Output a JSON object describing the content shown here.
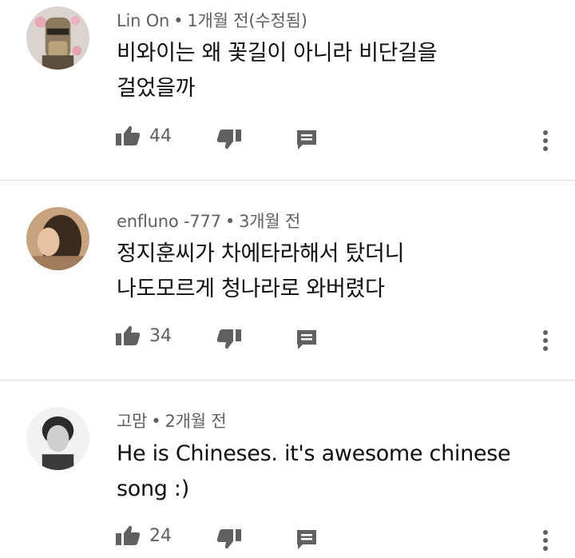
{
  "comments": [
    {
      "author": "Lin On",
      "separator": "•",
      "time": "1개월 전(수정됨)",
      "text_lines": [
        "비와이는 왜 꽃길이 아니라 비단길을",
        "걸었을까"
      ],
      "likes": "44"
    },
    {
      "author": "enfluno -777",
      "separator": "•",
      "time": "3개월 전",
      "text_lines": [
        "정지훈씨가 차에타라해서 탔더니",
        "나도모르게 청나라로 와버렸다"
      ],
      "likes": "34"
    },
    {
      "author": "고맘",
      "separator": "•",
      "time": "2개월 전",
      "text_lines": [
        "He is Chineses. it's awesome chinese",
        "song :)"
      ],
      "likes": "24"
    }
  ],
  "icons": {
    "like": "thumbs-up-icon",
    "dislike": "thumbs-down-icon",
    "reply": "reply-comment-icon",
    "more": "more-vertical-icon"
  },
  "colors": {
    "text": "#0f0f0f",
    "meta": "#606060",
    "icon": "#606060",
    "divider": "#dcdcdc"
  }
}
